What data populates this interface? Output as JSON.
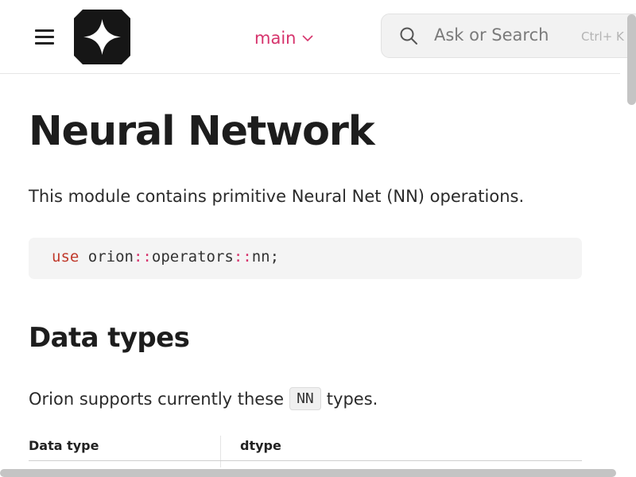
{
  "header": {
    "branch_label": "main",
    "search": {
      "placeholder": "Ask or Search",
      "shortcut": "Ctrl+ K"
    }
  },
  "main": {
    "title": "Neural Network",
    "intro": "This module contains primitive Neural Net (NN) operations.",
    "code": {
      "keyword": "use",
      "segments": [
        "orion",
        "::",
        "operators",
        "::",
        "nn;"
      ]
    },
    "section_title": "Data types",
    "support_text_before": "Orion supports currently these",
    "support_inline_code": "NN",
    "support_text_after": "types.",
    "table": {
      "headers": [
        "Data type",
        "dtype"
      ]
    }
  },
  "icons": {
    "menu": "hamburger-menu-icon",
    "logo": "four-point-star-logo",
    "branch_chevron": "chevron-down-icon",
    "search": "search-icon"
  },
  "colors": {
    "accent": "#d6336c",
    "keyword": "#c0392b",
    "code_bg": "#f4f4f4",
    "search_bg": "#f2f2f2"
  }
}
